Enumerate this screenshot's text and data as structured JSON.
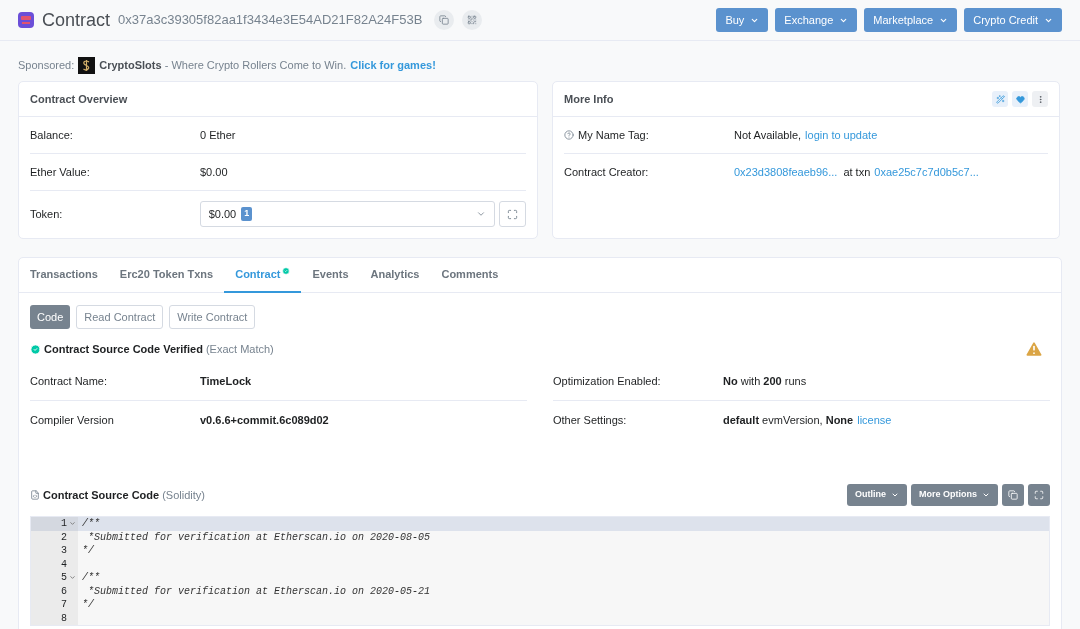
{
  "header": {
    "title": "Contract",
    "address": "0x37a3c39305f82aa1f3434e3E54AD21F82A24F53B",
    "menus": [
      "Buy",
      "Exchange",
      "Marketplace",
      "Crypto Credit"
    ]
  },
  "sponsor": {
    "label": "Sponsored:",
    "text": "**CryptoSlots** - Where Crypto Rollers Come to Win.",
    "link": "Click for games!"
  },
  "overview": {
    "title": "Contract Overview",
    "rows": [
      {
        "label": "Balance:",
        "value": "0 Ether"
      },
      {
        "label": "Ether Value:",
        "value": "$0.00"
      }
    ],
    "token": {
      "label": "Token:",
      "value": "$0.00",
      "count": "1"
    }
  },
  "more_info": {
    "title": "More Info",
    "name_tag": {
      "label": "My Name Tag:",
      "value": "Not Available,",
      "link": "login to update"
    },
    "creator": {
      "label": "Contract Creator:",
      "address": "0x23d3808feaeb96...",
      "between": "at txn",
      "txn": "0xae25c7c7d0b5c7..."
    }
  },
  "tabs": [
    {
      "label": "Transactions",
      "selected": false,
      "verified": false
    },
    {
      "label": "Erc20 Token Txns",
      "selected": false,
      "verified": false
    },
    {
      "label": "Contract",
      "selected": true,
      "verified": true
    },
    {
      "label": "Events",
      "selected": false,
      "verified": false
    },
    {
      "label": "Analytics",
      "selected": false,
      "verified": false
    },
    {
      "label": "Comments",
      "selected": false,
      "verified": false
    }
  ],
  "subtabs": [
    {
      "label": "Code",
      "selected": true
    },
    {
      "label": "Read Contract",
      "selected": false
    },
    {
      "label": "Write Contract",
      "selected": false
    }
  ],
  "verified": {
    "title": "Contract Source Code Verified",
    "note": "(Exact Match)"
  },
  "details_left": [
    {
      "label": "Contract Name:",
      "value": "**TimeLock**"
    },
    {
      "label": "Compiler Version",
      "value": "**v0.6.6+commit.6c089d02**"
    }
  ],
  "details_right": [
    {
      "label": "Optimization Enabled:",
      "value": "**No** with **200** runs"
    },
    {
      "label": "Other Settings:",
      "value": "**default** evmVersion, **None**",
      "link": "license"
    }
  ],
  "source": {
    "title": "Contract Source Code",
    "language": "(Solidity)",
    "buttons": [
      "Outline",
      "More Options"
    ],
    "lines": [
      {
        "number": "1",
        "text": "/**",
        "fold": true,
        "active": true
      },
      {
        "number": "2",
        "text": " *Submitted for verification at Etherscan.io on 2020-08-05",
        "fold": false,
        "active": false
      },
      {
        "number": "3",
        "text": "*/",
        "fold": false,
        "active": false
      },
      {
        "number": "4",
        "fold": false,
        "active": false
      },
      {
        "number": "5",
        "text": "/**",
        "fold": true,
        "active": false
      },
      {
        "number": "6",
        "text": " *Submitted for verification at Etherscan.io on 2020-05-21",
        "fold": false,
        "active": false
      },
      {
        "number": "7",
        "text": "*/",
        "fold": false,
        "active": false
      },
      {
        "number": "8",
        "fold": false,
        "active": false
      }
    ]
  }
}
